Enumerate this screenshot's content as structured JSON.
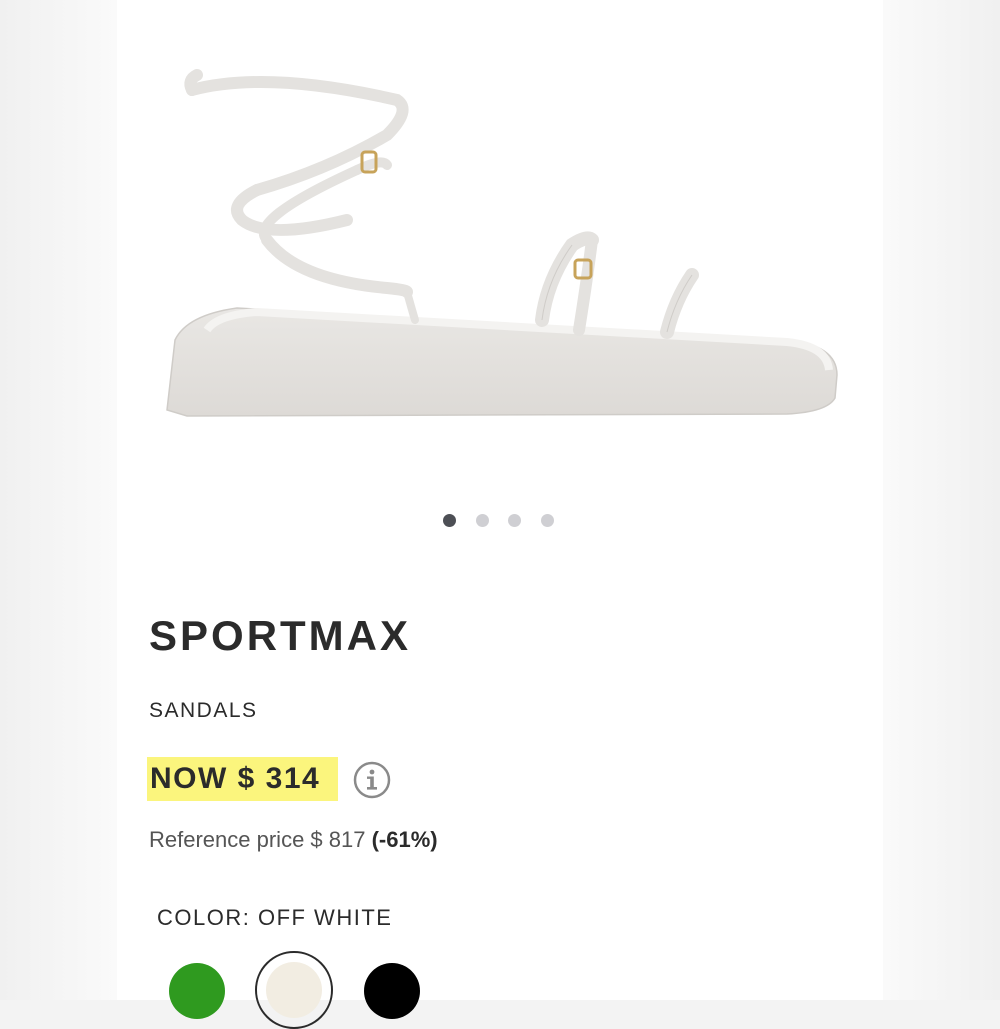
{
  "product": {
    "brand": "SPORTMAX",
    "category": "SANDALS",
    "price_now": "NOW $ 314",
    "reference_price_label": "Reference price $ 817",
    "discount": "(-61%)",
    "color_label": "COLOR: OFF WHITE"
  },
  "gallery": {
    "image_count": 4,
    "active_index": 0
  },
  "colors": [
    {
      "name": "green",
      "hex": "#2f9a1f"
    },
    {
      "name": "off white",
      "hex": "#f2ede2",
      "selected": true
    },
    {
      "name": "black",
      "hex": "#000000"
    }
  ],
  "theme": {
    "price_highlight": "#fbf57d",
    "text": "#2b2b2b"
  }
}
